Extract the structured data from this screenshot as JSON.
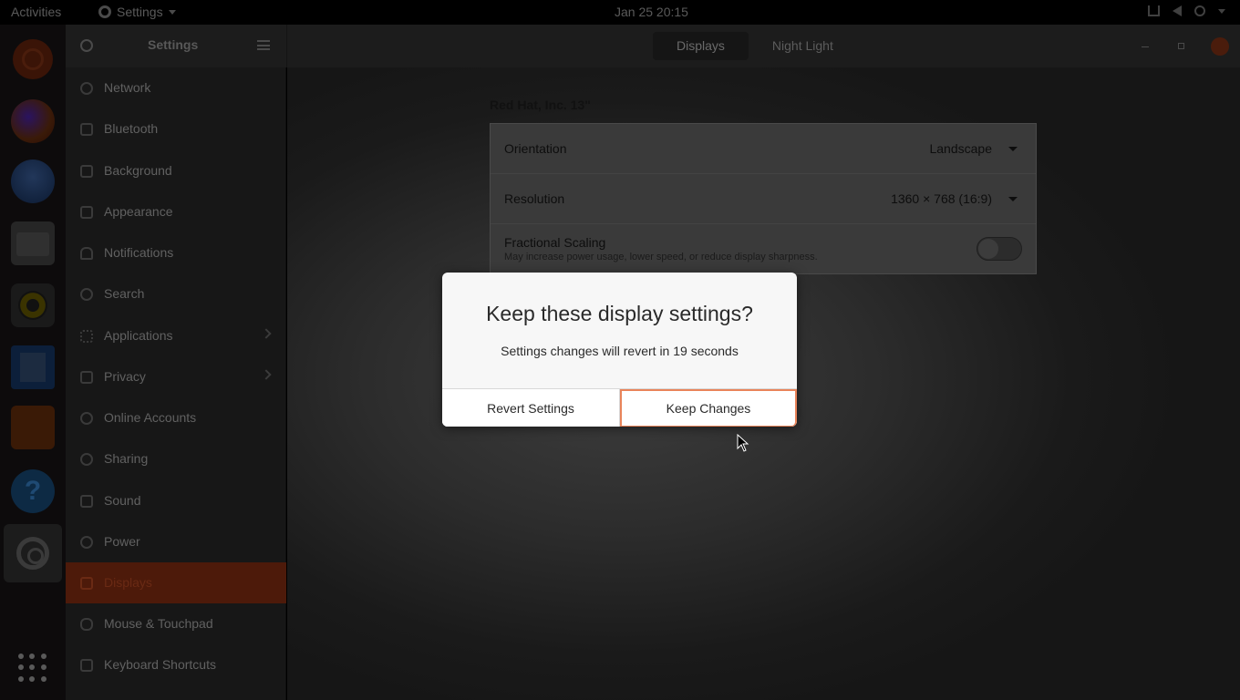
{
  "topbar": {
    "activities": "Activities",
    "app_menu": "Settings",
    "clock": "Jan 25  20:15"
  },
  "header": {
    "title": "Settings",
    "tabs": [
      {
        "label": "Displays",
        "active": true
      },
      {
        "label": "Night Light",
        "active": false
      }
    ]
  },
  "sidebar": {
    "items": [
      {
        "label": "Network",
        "icon": "network-icon"
      },
      {
        "label": "Bluetooth",
        "icon": "bluetooth-icon"
      },
      {
        "label": "Background",
        "icon": "background-icon"
      },
      {
        "label": "Appearance",
        "icon": "appearance-icon"
      },
      {
        "label": "Notifications",
        "icon": "bell-icon"
      },
      {
        "label": "Search",
        "icon": "search-icon"
      },
      {
        "label": "Applications",
        "icon": "applications-icon",
        "has_submenu": true
      },
      {
        "label": "Privacy",
        "icon": "lock-icon",
        "has_submenu": true
      },
      {
        "label": "Online Accounts",
        "icon": "cloud-icon"
      },
      {
        "label": "Sharing",
        "icon": "share-icon"
      },
      {
        "label": "Sound",
        "icon": "music-note-icon"
      },
      {
        "label": "Power",
        "icon": "power-icon"
      },
      {
        "label": "Displays",
        "icon": "display-icon",
        "selected": true
      },
      {
        "label": "Mouse & Touchpad",
        "icon": "mouse-icon"
      },
      {
        "label": "Keyboard Shortcuts",
        "icon": "keyboard-icon"
      }
    ]
  },
  "display": {
    "monitor_name": "Red Hat, Inc. 13\"",
    "orientation": {
      "label": "Orientation",
      "value": "Landscape"
    },
    "resolution": {
      "label": "Resolution",
      "value": "1360 × 768 (16:9)"
    },
    "fractional_scaling": {
      "label": "Fractional Scaling",
      "description": "May increase power usage, lower speed, or reduce display sharpness.",
      "enabled": false
    }
  },
  "dialog": {
    "title": "Keep these display settings?",
    "message": "Settings changes will revert in 19 seconds",
    "revert_label": "Revert Settings",
    "keep_label": "Keep Changes"
  },
  "colors": {
    "accent": "#e9845a",
    "selected_sidebar": "#4d1a0a"
  }
}
